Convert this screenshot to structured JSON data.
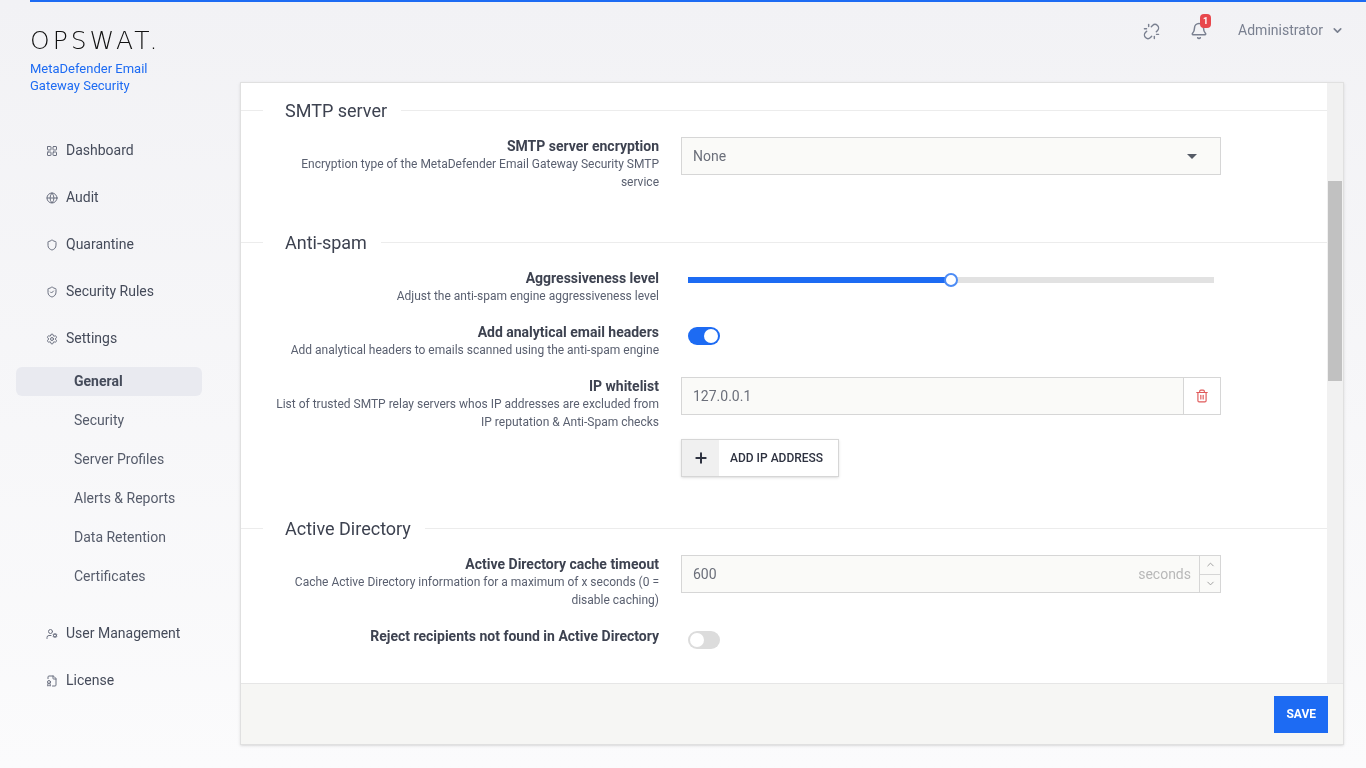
{
  "brand": {
    "logo": "OPSWAT.",
    "product": "MetaDefender Email Gateway Security"
  },
  "topbar": {
    "notifications": "1",
    "user": "Administrator"
  },
  "sidebar": {
    "items": [
      {
        "label": "Dashboard",
        "selected": false
      },
      {
        "label": "Audit",
        "selected": false
      },
      {
        "label": "Quarantine",
        "selected": false
      },
      {
        "label": "Security Rules",
        "selected": false
      },
      {
        "label": "Settings",
        "selected": false,
        "children": [
          {
            "label": "General",
            "selected": true
          },
          {
            "label": "Security",
            "selected": false
          },
          {
            "label": "Server Profiles",
            "selected": false
          },
          {
            "label": "Alerts & Reports",
            "selected": false
          },
          {
            "label": "Data Retention",
            "selected": false
          },
          {
            "label": "Certificates",
            "selected": false
          }
        ]
      },
      {
        "label": "User Management",
        "selected": false
      },
      {
        "label": "License",
        "selected": false
      }
    ]
  },
  "sections": [
    {
      "title": "SMTP server",
      "rows": [
        {
          "kind": "select",
          "label": "SMTP server encryption",
          "description": "Encryption type of the MetaDefender Email Gateway Security SMTP service",
          "value": "None"
        }
      ]
    },
    {
      "title": "Anti-spam",
      "rows": [
        {
          "kind": "slider",
          "label": "Aggressiveness level",
          "description": "Adjust the anti-spam engine aggressiveness level",
          "level": 0.5
        },
        {
          "kind": "toggle",
          "label": "Add analytical email headers",
          "description": "Add analytical headers to emails scanned using the anti-spam engine",
          "on": true
        },
        {
          "kind": "ip_list",
          "label": "IP whitelist",
          "description": "List of trusted SMTP relay servers whos IP addresses are excluded from IP reputation & Anti-Spam checks",
          "entries": [
            "127.0.0.1"
          ],
          "add_button": "ADD IP ADDRESS"
        }
      ]
    },
    {
      "title": "Active Directory",
      "rows": [
        {
          "kind": "number",
          "label": "Active Directory cache timeout",
          "description": "Cache Active Directory information for a maximum of x seconds (0 = disable caching)",
          "value": "600",
          "unit": "seconds"
        },
        {
          "kind": "toggle",
          "label": "Reject recipients not found in Active Directory",
          "on": false
        }
      ]
    }
  ],
  "footer": {
    "save": "SAVE"
  }
}
